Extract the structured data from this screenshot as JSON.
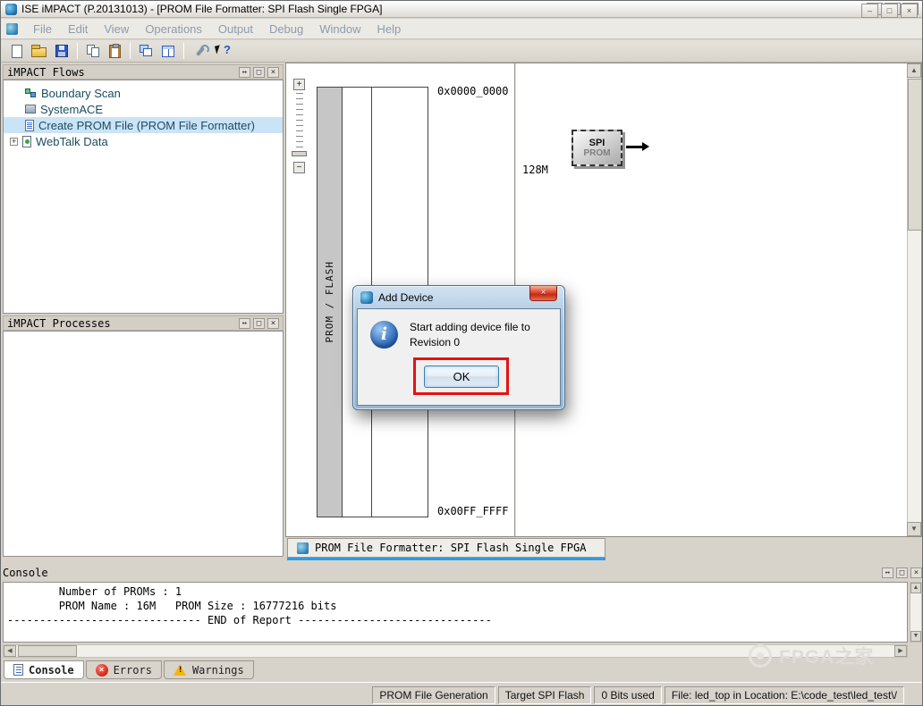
{
  "window": {
    "title": "ISE iMPACT (P.20131013) - [PROM File Formatter: SPI Flash Single FPGA]"
  },
  "menu": {
    "items": [
      "File",
      "Edit",
      "View",
      "Operations",
      "Output",
      "Debug",
      "Window",
      "Help"
    ]
  },
  "flows_panel": {
    "title": "iMPACT Flows",
    "items": [
      {
        "label": "Boundary Scan"
      },
      {
        "label": "SystemACE"
      },
      {
        "label": "Create PROM File (PROM File Formatter)"
      },
      {
        "label": "WebTalk Data"
      }
    ]
  },
  "processes_panel": {
    "title": "iMPACT Processes"
  },
  "workspace": {
    "addr_top": "0x0000_0000",
    "addr_bottom": "0x00FF_FFFF",
    "density": "128M",
    "memory_label": "PROM / FLASH",
    "device": {
      "type": "SPI",
      "kind": "PROM"
    },
    "doc_tab": "PROM File Formatter: SPI Flash Single FPGA"
  },
  "dialog": {
    "title": "Add Device",
    "message_line1": "Start adding device file to",
    "message_line2": "Revision 0",
    "ok_label": "OK"
  },
  "console_panel": {
    "title": "Console",
    "lines": [
      "        Number of PROMs : 1",
      "        PROM Name : 16M   PROM Size : 16777216 bits",
      "------------------------------ END of Report ------------------------------"
    ]
  },
  "bottom_tabs": {
    "console": "Console",
    "errors": "Errors",
    "warnings": "Warnings"
  },
  "status_bar": {
    "segments": [
      "PROM File Generation",
      "Target SPI Flash",
      "0 Bits used",
      "File: led_top in Location: E:\\code_test\\led_test\\/"
    ]
  },
  "watermark": {
    "text": "FPGA之家"
  },
  "icons": {
    "minimize": "–",
    "maximize": "□",
    "close": "×",
    "dock": "↔",
    "float": "□",
    "up": "▲",
    "down": "▼",
    "left": "◀",
    "right": "▶",
    "zoom_in": "+",
    "zoom_out": "−",
    "expander": "+",
    "info": "i",
    "error": "×",
    "warning": "!",
    "help": "?"
  },
  "colors": {
    "annotation_red": "#e51212",
    "tab_accent_blue": "#2e9ae5",
    "selection_blue": "#cbe3f7"
  }
}
